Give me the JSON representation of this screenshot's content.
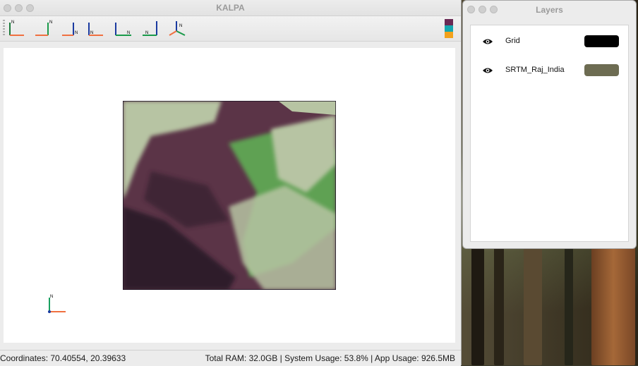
{
  "main_window": {
    "title": "KALPA",
    "color_bar": [
      "#6a2a55",
      "#16a8b0",
      "#f3a21c"
    ]
  },
  "toolbar": {
    "buttons": [
      "view-north-icon",
      "view-east-icon",
      "view-south-icon",
      "view-west-icon",
      "view-top-icon",
      "view-bottom-icon",
      "view-3d-icon"
    ]
  },
  "map": {
    "layer_colors": {
      "low": "#2d1a2c",
      "mid": "#5b3447",
      "vegetation": "#5fa152",
      "high": "#b7c4a3"
    }
  },
  "axis_label": "N",
  "statusbar": {
    "coordinates": "Coordinates: 70.40554, 20.39633",
    "resources": "Total RAM: 32.0GB | System Usage: 53.8% | App Usage: 926.5MB"
  },
  "layers_window": {
    "title": "Layers",
    "layers": [
      {
        "name": "Grid",
        "visible_icon": "eye-icon",
        "color": "#000000"
      },
      {
        "name": "SRTM_Raj_India",
        "visible_icon": "eye-icon",
        "color": "#6d6c52"
      }
    ]
  }
}
